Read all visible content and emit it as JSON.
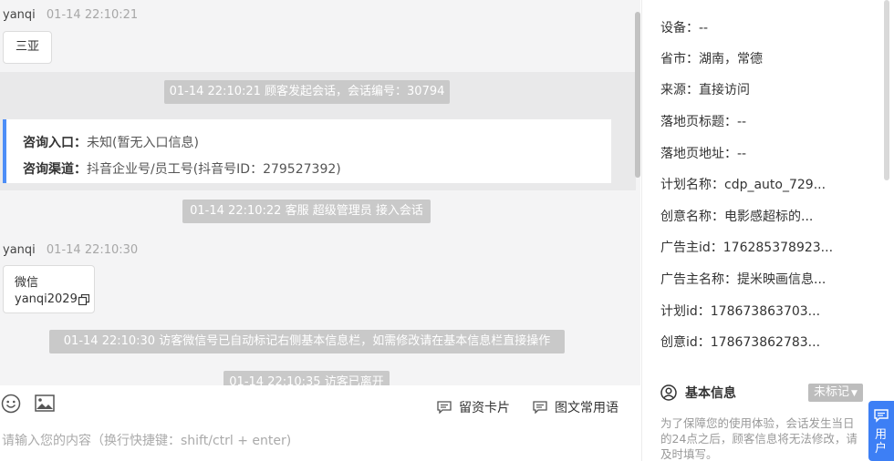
{
  "chat": {
    "messages": [
      {
        "sender": "yanqi",
        "time": "01-14 22:10:21",
        "text": "三亚"
      },
      {
        "sender": "yanqi",
        "time": "01-14 22:10:30",
        "line1": "微信",
        "line2": "yanqi2029"
      }
    ],
    "system": [
      "01-14 22:10:21 顾客发起会话，会话编号：30794",
      "01-14 22:10:22 客服 超级管理员 接入会话",
      "01-14 22:10:30 访客微信号已自动标记右侧基本信息栏，如需修改请在基本信息栏直接操作",
      "01-14 22:10:35 访客已离开"
    ],
    "entry_card": {
      "entry_label": "咨询入口：",
      "entry_value": "未知(暂无入口信息)",
      "channel_label": "咨询渠道：",
      "channel_value": "抖音企业号/员工号(抖音号ID：279527392)"
    }
  },
  "toolbar": {
    "icons": [
      "emoji-icon",
      "image-icon"
    ],
    "card_label": "留资卡片",
    "phrases_label": "图文常用语"
  },
  "input": {
    "placeholder": "请输入您的内容（换行快捷键：shift/ctrl + enter)"
  },
  "info_panel": {
    "rows": [
      "设备：--",
      "省市：湖南，常德",
      "来源：直接访问",
      "落地页标题：--",
      "落地页地址：--",
      "计划名称：cdp_auto_729...",
      "创意名称：电影感超标的...",
      "广告主id：176285378923...",
      "广告主名称：提米映画信息...",
      "计划id：178673863703...",
      "创意id：178673862783..."
    ],
    "section_title": "基本信息",
    "mark_tag": "未标记",
    "notice": "为了保障您的使用体验，会话发生当日的24点之后，顾客信息将无法修改，请及时填写。"
  },
  "user_tab": {
    "label": "用户"
  },
  "colors": {
    "accent": "#4d8ef7",
    "tab": "#3d7ff5",
    "system_bar": "#c9c9c9"
  }
}
